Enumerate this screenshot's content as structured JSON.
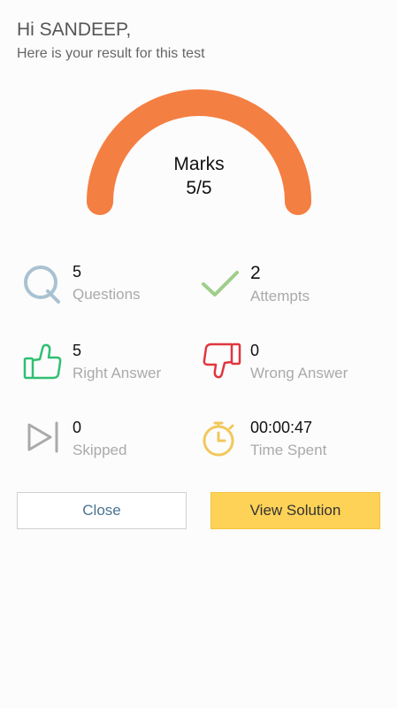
{
  "header": {
    "greeting": "Hi SANDEEP,",
    "subtitle": "Here is your result for this test"
  },
  "score": {
    "label": "Marks",
    "value": "5/5",
    "fraction": 1.0,
    "color": "#f47f42"
  },
  "stats": [
    {
      "icon": "question-icon",
      "value": "5",
      "caption": "Questions",
      "color": "#a9c2d2"
    },
    {
      "icon": "checkmark-icon",
      "value": "2",
      "caption": "Attempts",
      "color": "#9fce8a"
    },
    {
      "icon": "thumbs-up-icon",
      "value": "5",
      "caption": "Right Answer",
      "color": "#2fbf71"
    },
    {
      "icon": "thumbs-down-icon",
      "value": "0",
      "caption": "Wrong Answer",
      "color": "#e0363e"
    },
    {
      "icon": "skip-icon",
      "value": "0",
      "caption": "Skipped",
      "color": "#aaaaaa"
    },
    {
      "icon": "stopwatch-icon",
      "value": "00:00:47",
      "caption": "Time Spent",
      "color": "#f2c75c"
    }
  ],
  "actions": {
    "close_label": "Close",
    "solution_label": "View Solution"
  }
}
